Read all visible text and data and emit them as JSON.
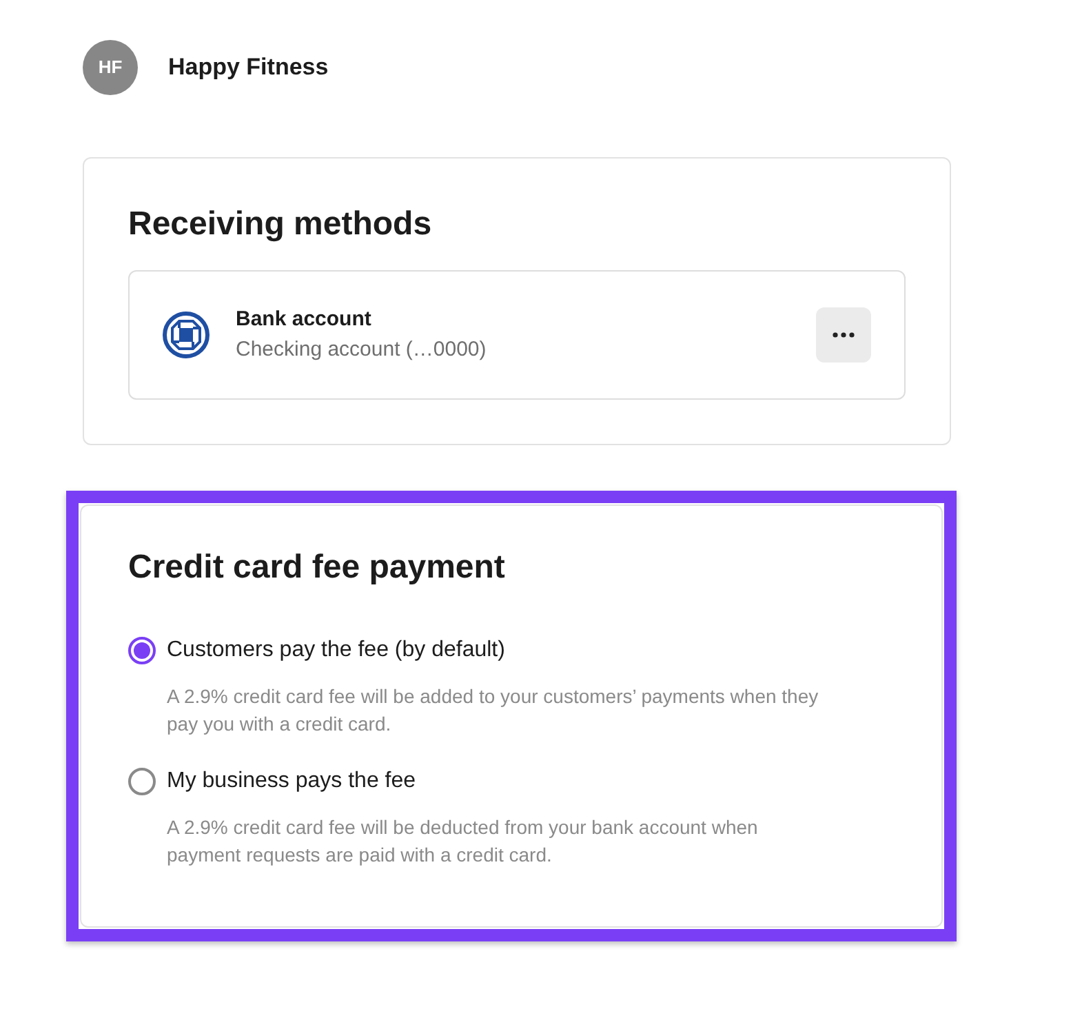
{
  "business": {
    "initials": "HF",
    "name": "Happy Fitness"
  },
  "receiving_methods": {
    "title": "Receiving methods",
    "methods": [
      {
        "name": "Bank account",
        "detail": "Checking account (…0000)"
      }
    ]
  },
  "fee_payment": {
    "title": "Credit card fee payment",
    "highlighted": true,
    "options": [
      {
        "label": "Customers pay the fee (by default)",
        "description": "A 2.9% credit card fee will be added to your customers’ payments when they pay you with a credit card.",
        "selected": true
      },
      {
        "label": "My business pays the fee",
        "description": "A 2.9% credit card fee will be deducted from your bank account when payment requests are paid with a credit card.",
        "selected": false
      }
    ]
  }
}
